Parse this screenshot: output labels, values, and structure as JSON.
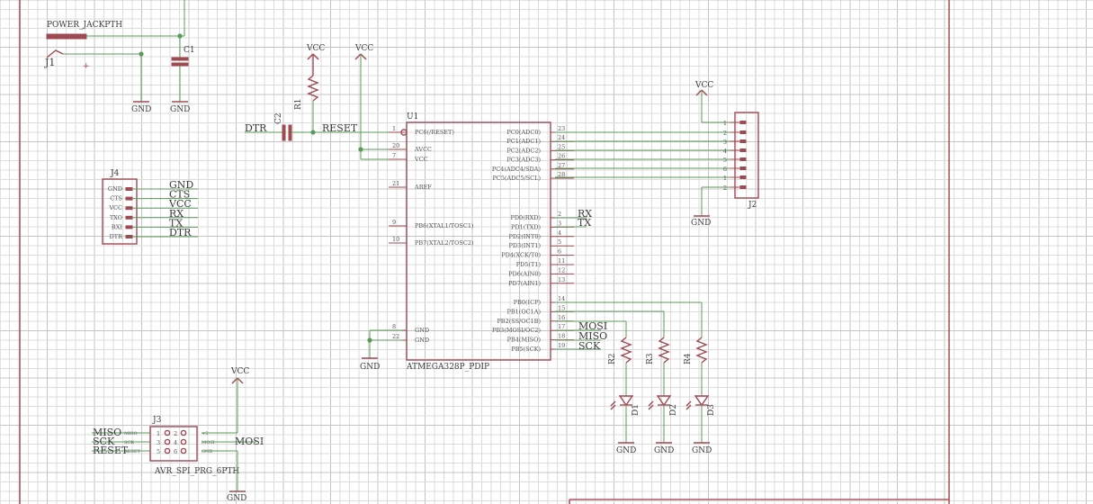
{
  "power_jack": {
    "name": "POWER_JACKPTH",
    "ref": "J1",
    "plus": "+"
  },
  "cap1": {
    "ref": "C1",
    "gnd": "GND"
  },
  "j1_gnd": "GND",
  "reset_circuit": {
    "vcc_r1": "VCC",
    "vcc_mcu": "VCC",
    "r1": "R1",
    "c2": "C2",
    "dtr": "DTR",
    "reset": "RESET"
  },
  "mcu": {
    "ref": "U1",
    "value": "ATMEGA328P_PDIP",
    "left_pins": [
      {
        "num": "1",
        "name": "PC6(/RESET)"
      },
      {
        "num": "20",
        "name": "AVCC"
      },
      {
        "num": "7",
        "name": "VCC"
      },
      {
        "num": "21",
        "name": "AREF"
      },
      {
        "num": "9",
        "name": "PB6(XTAL1/TOSC1)"
      },
      {
        "num": "10",
        "name": "PB7(XTAL2/TOSC2)"
      },
      {
        "num": "8",
        "name": "GND"
      },
      {
        "num": "22",
        "name": "GND"
      }
    ],
    "right_pins_top": [
      {
        "num": "23",
        "name": "PC0(ADC0)"
      },
      {
        "num": "24",
        "name": "PC1(ADC1)"
      },
      {
        "num": "25",
        "name": "PC2(ADC2)"
      },
      {
        "num": "26",
        "name": "PC3(ADC3)"
      },
      {
        "num": "27",
        "name": "PC4(ADC4/SDA)"
      },
      {
        "num": "28",
        "name": "PC5(ADC5/SCL)"
      }
    ],
    "right_pins_mid": [
      {
        "num": "2",
        "name": "PD0(RXD)"
      },
      {
        "num": "3",
        "name": "PD1(TXD)"
      },
      {
        "num": "4",
        "name": "PD2(INT0)"
      },
      {
        "num": "5",
        "name": "PD3(INT1)"
      },
      {
        "num": "6",
        "name": "PD4(XCK/T0)"
      },
      {
        "num": "11",
        "name": "PD5(T1)"
      },
      {
        "num": "12",
        "name": "PD6(AIN0)"
      },
      {
        "num": "13",
        "name": "PD7(AIN1)"
      }
    ],
    "right_pins_bot": [
      {
        "num": "14",
        "name": "PB0(ICP)"
      },
      {
        "num": "15",
        "name": "PB1(OC1A)"
      },
      {
        "num": "16",
        "name": "PB2(SS/OC1B)"
      },
      {
        "num": "17",
        "name": "PB3(MOSI/OC2)"
      },
      {
        "num": "18",
        "name": "PB4(MISO)"
      },
      {
        "num": "19",
        "name": "PB5(SCK)"
      }
    ],
    "gnd": "GND",
    "net_rx": "RX",
    "net_tx": "TX",
    "net_mosi": "MOSI",
    "net_miso": "MISO",
    "net_sck": "SCK"
  },
  "j2": {
    "ref": "J2",
    "vcc": "VCC",
    "gnd": "GND",
    "pins": [
      "1",
      "2",
      "3",
      "4",
      "5",
      "6",
      "1",
      "2"
    ]
  },
  "j4": {
    "ref": "J4",
    "pins": [
      "GND",
      "CTS",
      "VCC",
      "TXO",
      "RXI",
      "DTR"
    ],
    "nets": [
      "GND",
      "CTS",
      "VCC",
      "RX",
      "TX",
      "DTR"
    ]
  },
  "j3": {
    "ref": "J3",
    "value": "AVR_SPI_PRG_6PTH",
    "vcc": "VCC",
    "gnd": "GND",
    "left_nets": [
      "MISO",
      "SCK",
      "RESET"
    ],
    "left_nums": [
      "1",
      "3",
      "5"
    ],
    "right_nums": [
      "2",
      "4",
      "6"
    ],
    "left_pin_names": [
      "MISO",
      "SCK",
      "RESET"
    ],
    "right_pin_names": [
      "+5",
      "MOSI",
      "GND"
    ],
    "right_net": "MOSI"
  },
  "leds": [
    {
      "r": "R2",
      "d": "D1",
      "gnd": "GND"
    },
    {
      "r": "R3",
      "d": "D2",
      "gnd": "GND"
    },
    {
      "r": "R4",
      "d": "D3",
      "gnd": "GND"
    }
  ]
}
